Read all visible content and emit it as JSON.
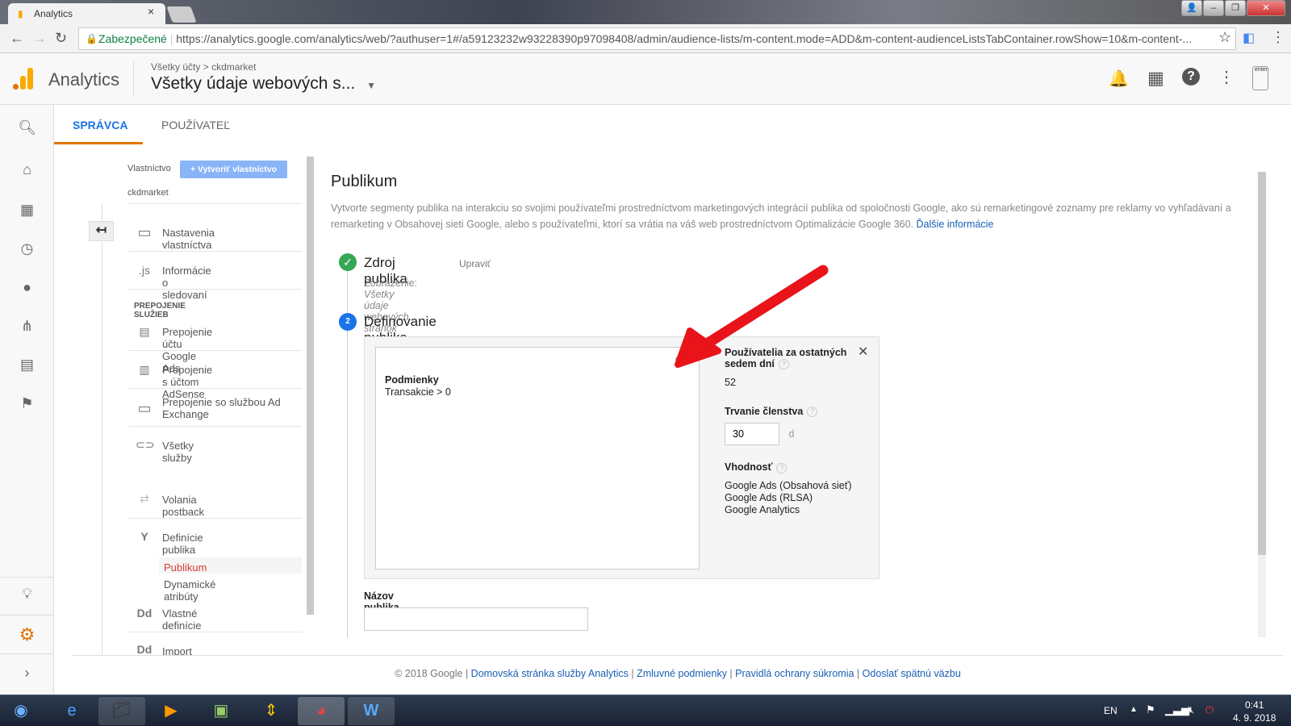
{
  "browser": {
    "tab_title": "Analytics",
    "close": "×",
    "secure_label": "Zabezpečené",
    "url": "https://analytics.google.com/analytics/web/?authuser=1#/a59123232w93228390p97098408/admin/audience-lists/m-content.mode=ADD&m-content-audienceListsTabContainer.rowShow=10&m-content-..."
  },
  "header": {
    "app_name": "Analytics",
    "breadcrumb_account": "Všetky účty",
    "breadcrumb_sep": ">",
    "breadcrumb_property": "ckdmarket",
    "view_name": "Všetky údaje webových s...",
    "avatar_text": "enter"
  },
  "tabs": [
    {
      "label": "SPRÁVCA"
    },
    {
      "label": "POUŽÍVATEĽ"
    }
  ],
  "admin_nav": {
    "property_label": "Vlastníctvo",
    "create_button": "+ Vytvoriť vlastníctvo",
    "property_name": "ckdmarket",
    "section_links": "PREPOJENIE SLUŽIEB",
    "items": [
      "Nastavenia vlastníctva",
      "Informácie o sledovaní",
      "Prepojenie účtu Google Ads",
      "Prepojenie s účtom AdSense",
      "Prepojenie so službou Ad Exchange",
      "Všetky služby",
      "Volania postback",
      "Definície publika",
      "Publikum",
      "Dynamické atribúty",
      "Vlastné definície",
      "Import údajov"
    ],
    "icons": {
      "js": ".js",
      "dd": "Dd"
    }
  },
  "main": {
    "title": "Publikum",
    "description": "Vytvorte segmenty publika na interakciu so svojimi používateľmi prostredníctvom marketingových integrácií publika od spoločnosti Google, ako sú remarketingové zoznamy pre reklamy vo vyhľadávaní a remarketing v Obsahovej sieti Google, alebo s používateľmi, ktorí sa vrátia na váš web prostredníctvom Optimalizácie Google 360.",
    "learn_more": "Ďalšie informácie",
    "step1": {
      "title": "Zdroj publika",
      "edit": "Upraviť",
      "view_label": "Zobrazenie:",
      "view_value": "Všetky údaje webových stránok"
    },
    "step2": {
      "number": "2",
      "title": "Definovanie publika",
      "conditions_label": "Podmienky",
      "conditions_value": "Transakcie > 0",
      "users_label": "Používatelia za ostatných sedem dní",
      "users_value": "52",
      "duration_label": "Trvanie členstva",
      "duration_value": "30",
      "duration_unit": "d",
      "eligibility_label": "Vhodnosť",
      "eligibility": [
        "Google Ads (Obsahová sieť)",
        "Google Ads (RLSA)",
        "Google Analytics"
      ]
    },
    "name_label": "Názov publika",
    "name_value": ""
  },
  "footer": {
    "copyright": "© 2018 Google",
    "links": [
      "Domovská stránka služby Analytics",
      "Zmluvné podmienky",
      "Pravidlá ochrany súkromia",
      "Odoslať spätnú väzbu"
    ]
  },
  "taskbar": {
    "lang": "EN",
    "time": "0:41",
    "date": "4. 9. 2018"
  },
  "colors": {
    "accent": "#1a73e8",
    "active_nav": "#d23f31",
    "arrow": "#e8141a",
    "success": "#34a853"
  }
}
